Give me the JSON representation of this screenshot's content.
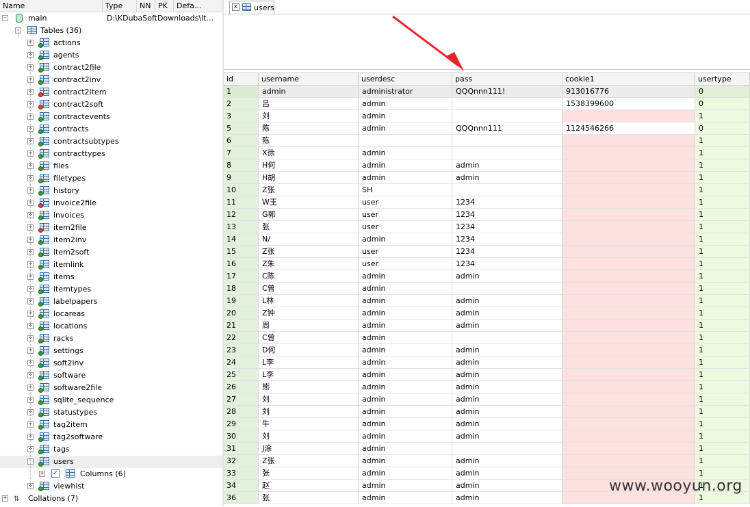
{
  "tree": {
    "header": {
      "name": "Name",
      "type": "Type",
      "nn": "NN",
      "pk": "PK",
      "default": "Defa..."
    },
    "db": {
      "name": "main",
      "path": "D:\\KDubaSoftDownloads\\it..."
    },
    "tables_label": "Tables (36)",
    "tables": [
      "actions",
      "agents",
      "contract2file",
      "contract2inv",
      "contract2item",
      "contract2soft",
      "contractevents",
      "contracts",
      "contractsubtypes",
      "contracttypes",
      "files",
      "filetypes",
      "history",
      "invoice2file",
      "invoices",
      "item2file",
      "item2inv",
      "item2soft",
      "itemlink",
      "items",
      "itemtypes",
      "labelpapers",
      "locareas",
      "locations",
      "racks",
      "settings",
      "soft2inv",
      "software",
      "software2file",
      "sqlite_sequence",
      "statustypes",
      "tag2item",
      "tag2software",
      "tags",
      "users"
    ],
    "columns_label": "Columns (6)",
    "after_users": [
      "viewhist"
    ],
    "collations_label": "Collations (7)"
  },
  "tab": {
    "label": "users"
  },
  "grid": {
    "columns": [
      "id",
      "username",
      "userdesc",
      "pass",
      "cookie1",
      "usertype"
    ],
    "rows": [
      [
        "1",
        "admin",
        "administrator",
        "QQQnnn111!",
        "913016776",
        "0"
      ],
      [
        "2",
        "吕",
        "admin",
        "",
        "1538399600",
        "0"
      ],
      [
        "3",
        "刘",
        "admin",
        "",
        "",
        "1"
      ],
      [
        "5",
        "陈",
        "admin",
        "QQQnnn111",
        "1124546266",
        "0"
      ],
      [
        "6",
        "陈",
        "",
        "",
        "",
        "1"
      ],
      [
        "7",
        "X徐",
        "admin",
        "",
        "",
        "1"
      ],
      [
        "8",
        "H何",
        "admin",
        "admin",
        "",
        "1"
      ],
      [
        "9",
        "H胡",
        "admin",
        "admin",
        "",
        "1"
      ],
      [
        "10",
        "Z张",
        "SH",
        "",
        "",
        "1"
      ],
      [
        "11",
        "W王",
        "user",
        "1234",
        "",
        "1"
      ],
      [
        "12",
        "G郭",
        "user",
        "1234",
        "",
        "1"
      ],
      [
        "13",
        "张",
        "user",
        "1234",
        "",
        "1"
      ],
      [
        "14",
        "N/",
        "admin",
        "1234",
        "",
        "1"
      ],
      [
        "15",
        "Z张",
        "user",
        "1234",
        "",
        "1"
      ],
      [
        "16",
        "Z朱",
        "user",
        "1234",
        "",
        "1"
      ],
      [
        "17",
        "C陈",
        "admin",
        "admin",
        "",
        "1"
      ],
      [
        "18",
        "C曾",
        "admin",
        "",
        "",
        "1"
      ],
      [
        "19",
        "L林",
        "admin",
        "admin",
        "",
        "1"
      ],
      [
        "20",
        "Z钟",
        "admin",
        "admin",
        "",
        "1"
      ],
      [
        "21",
        "周",
        "admin",
        "admin",
        "",
        "1"
      ],
      [
        "22",
        "C曾",
        "admin",
        "",
        "",
        "1"
      ],
      [
        "23",
        "D何",
        "admin",
        "admin",
        "",
        "1"
      ],
      [
        "24",
        "L李",
        "admin",
        "admin",
        "",
        "1"
      ],
      [
        "25",
        "L李",
        "admin",
        "admin",
        "",
        "1"
      ],
      [
        "26",
        "熊",
        "admin",
        "admin",
        "",
        "1"
      ],
      [
        "27",
        "刘",
        "admin",
        "admin",
        "",
        "1"
      ],
      [
        "28",
        "刘",
        "admin",
        "admin",
        "",
        "1"
      ],
      [
        "29",
        "牛",
        "admin",
        "admin",
        "",
        "1"
      ],
      [
        "30",
        "刘",
        "admin",
        "admin",
        "",
        "1"
      ],
      [
        "31",
        "J涂",
        "admin",
        "",
        "",
        "1"
      ],
      [
        "32",
        "Z张",
        "admin",
        "admin",
        "",
        "1"
      ],
      [
        "33",
        "张",
        "admin",
        "admin",
        "",
        "1"
      ],
      [
        "34",
        "赵",
        "admin",
        "admin",
        "",
        "1"
      ],
      [
        "36",
        "张",
        "admin",
        "admin",
        "",
        "1"
      ]
    ]
  },
  "watermark": "www.wooyun.org",
  "colors": {
    "arrow": "#e8262a",
    "id_bg": "#e3f1dc",
    "cookie_empty_bg": "#fde0e0",
    "usertype_bg": "#eefadf"
  }
}
